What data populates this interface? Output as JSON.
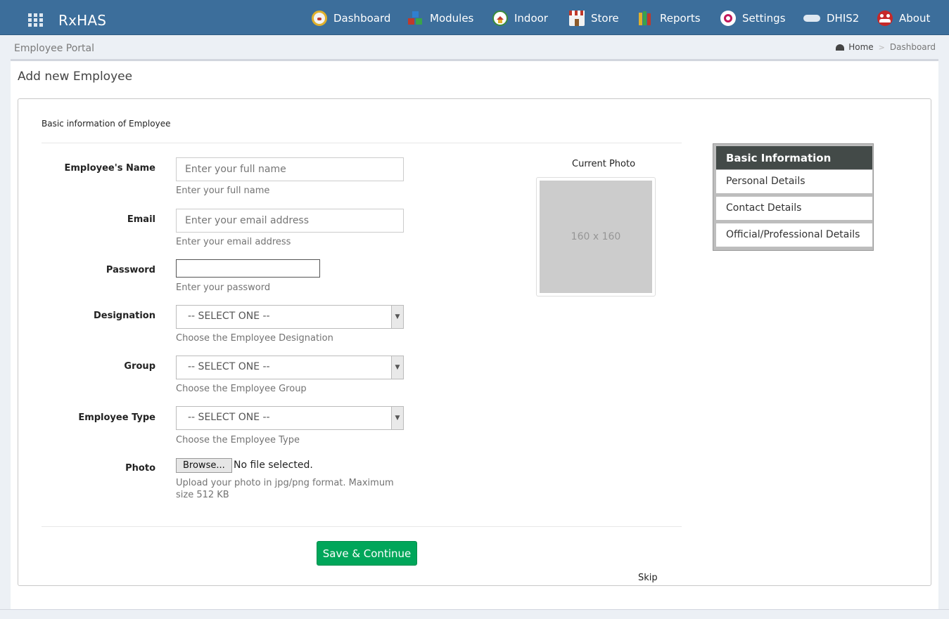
{
  "navbar": {
    "brand": "RxHAS",
    "items": [
      {
        "label": "Dashboard",
        "icon": "speedometer-icon"
      },
      {
        "label": "Modules",
        "icon": "blocks-icon"
      },
      {
        "label": "Indoor",
        "icon": "house-icon"
      },
      {
        "label": "Store",
        "icon": "store-icon"
      },
      {
        "label": "Reports",
        "icon": "books-icon"
      },
      {
        "label": "Settings",
        "icon": "gear-icon"
      },
      {
        "label": "DHIS2",
        "icon": "dhis2-logo-icon"
      },
      {
        "label": "About",
        "icon": "people-icon"
      }
    ]
  },
  "subheader": {
    "portal": "Employee Portal",
    "home": "Home",
    "current": "Dashboard"
  },
  "page": {
    "title": "Add new Employee",
    "section": "Basic information of Employee"
  },
  "form": {
    "name": {
      "label": "Employee's Name",
      "placeholder": "Enter your full name",
      "help": "Enter your full name"
    },
    "email": {
      "label": "Email",
      "placeholder": "Enter your email address",
      "help": "Enter your email address"
    },
    "password": {
      "label": "Password",
      "help": "Enter your password"
    },
    "designation": {
      "label": "Designation",
      "value": "-- SELECT ONE --",
      "help": "Choose the Employee Designation"
    },
    "group": {
      "label": "Group",
      "value": "-- SELECT ONE --",
      "help": "Choose the Employee Group"
    },
    "type": {
      "label": "Employee Type",
      "value": "-- SELECT ONE --",
      "help": "Choose the Employee Type"
    },
    "photo": {
      "label": "Photo",
      "browse": "Browse...",
      "status": "No file selected.",
      "help": "Upload your photo in jpg/png format. Maximum size 512 KB"
    }
  },
  "photo_preview": {
    "label": "Current Photo",
    "placeholder": "160 x 160"
  },
  "actions": {
    "save": "Save & Continue",
    "skip": "Skip"
  },
  "sidenav": {
    "items": [
      {
        "label": "Basic Information",
        "active": true
      },
      {
        "label": "Personal Details",
        "active": false
      },
      {
        "label": "Contact Details",
        "active": false
      },
      {
        "label": "Official/Professional Details",
        "active": false
      }
    ]
  },
  "colors": {
    "navbar": "#3c6e9b",
    "save_button": "#00a65a",
    "sidenav_active": "#434a48",
    "page_background": "#ecf0f5"
  }
}
